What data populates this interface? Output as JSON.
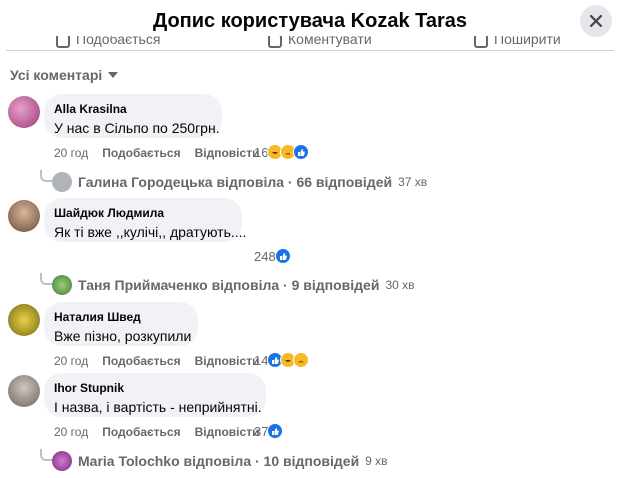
{
  "header": {
    "title": "Допис користувача Kozak Taras"
  },
  "actions": {
    "like": "Подобається",
    "comment": "Коментувати",
    "share": "Поширити"
  },
  "filter": {
    "label": "Усі коментарі"
  },
  "comments": [
    {
      "author": "Alla Krasilna",
      "text": "У нас в Сільпо по 250грн.",
      "time": "20 год",
      "like": "Подобається",
      "reply": "Відповісти",
      "reactions": "16",
      "replies": {
        "text": "Галина Городецька відповіла · 66 відповідей",
        "time": "37 хв"
      }
    },
    {
      "author": "Шайдюк Людмила",
      "text": "Як ті вже ,,кулічі,, дратують....",
      "reactions": "248",
      "replies": {
        "text": "Таня Приймаченко відповіла · 9 відповідей",
        "time": "30 хв"
      }
    },
    {
      "author": "Наталия Швед",
      "text": "Вже пізно, розкупили",
      "time": "20 год",
      "like": "Подобається",
      "reply": "Відповісти",
      "reactions": "14"
    },
    {
      "author": "Ihor Stupnik",
      "text": "І назва, і вартість - неприйнятні.",
      "time": "20 год",
      "like": "Подобається",
      "reply": "Відповісти",
      "reactions": "37",
      "replies": {
        "text": "Maria Tolochko відповіла · 10 відповідей",
        "time": "9 хв"
      }
    }
  ],
  "colors": {
    "bubble": "#f0f2f5",
    "like_blue": "#1b74e4",
    "muted": "#65676b"
  }
}
